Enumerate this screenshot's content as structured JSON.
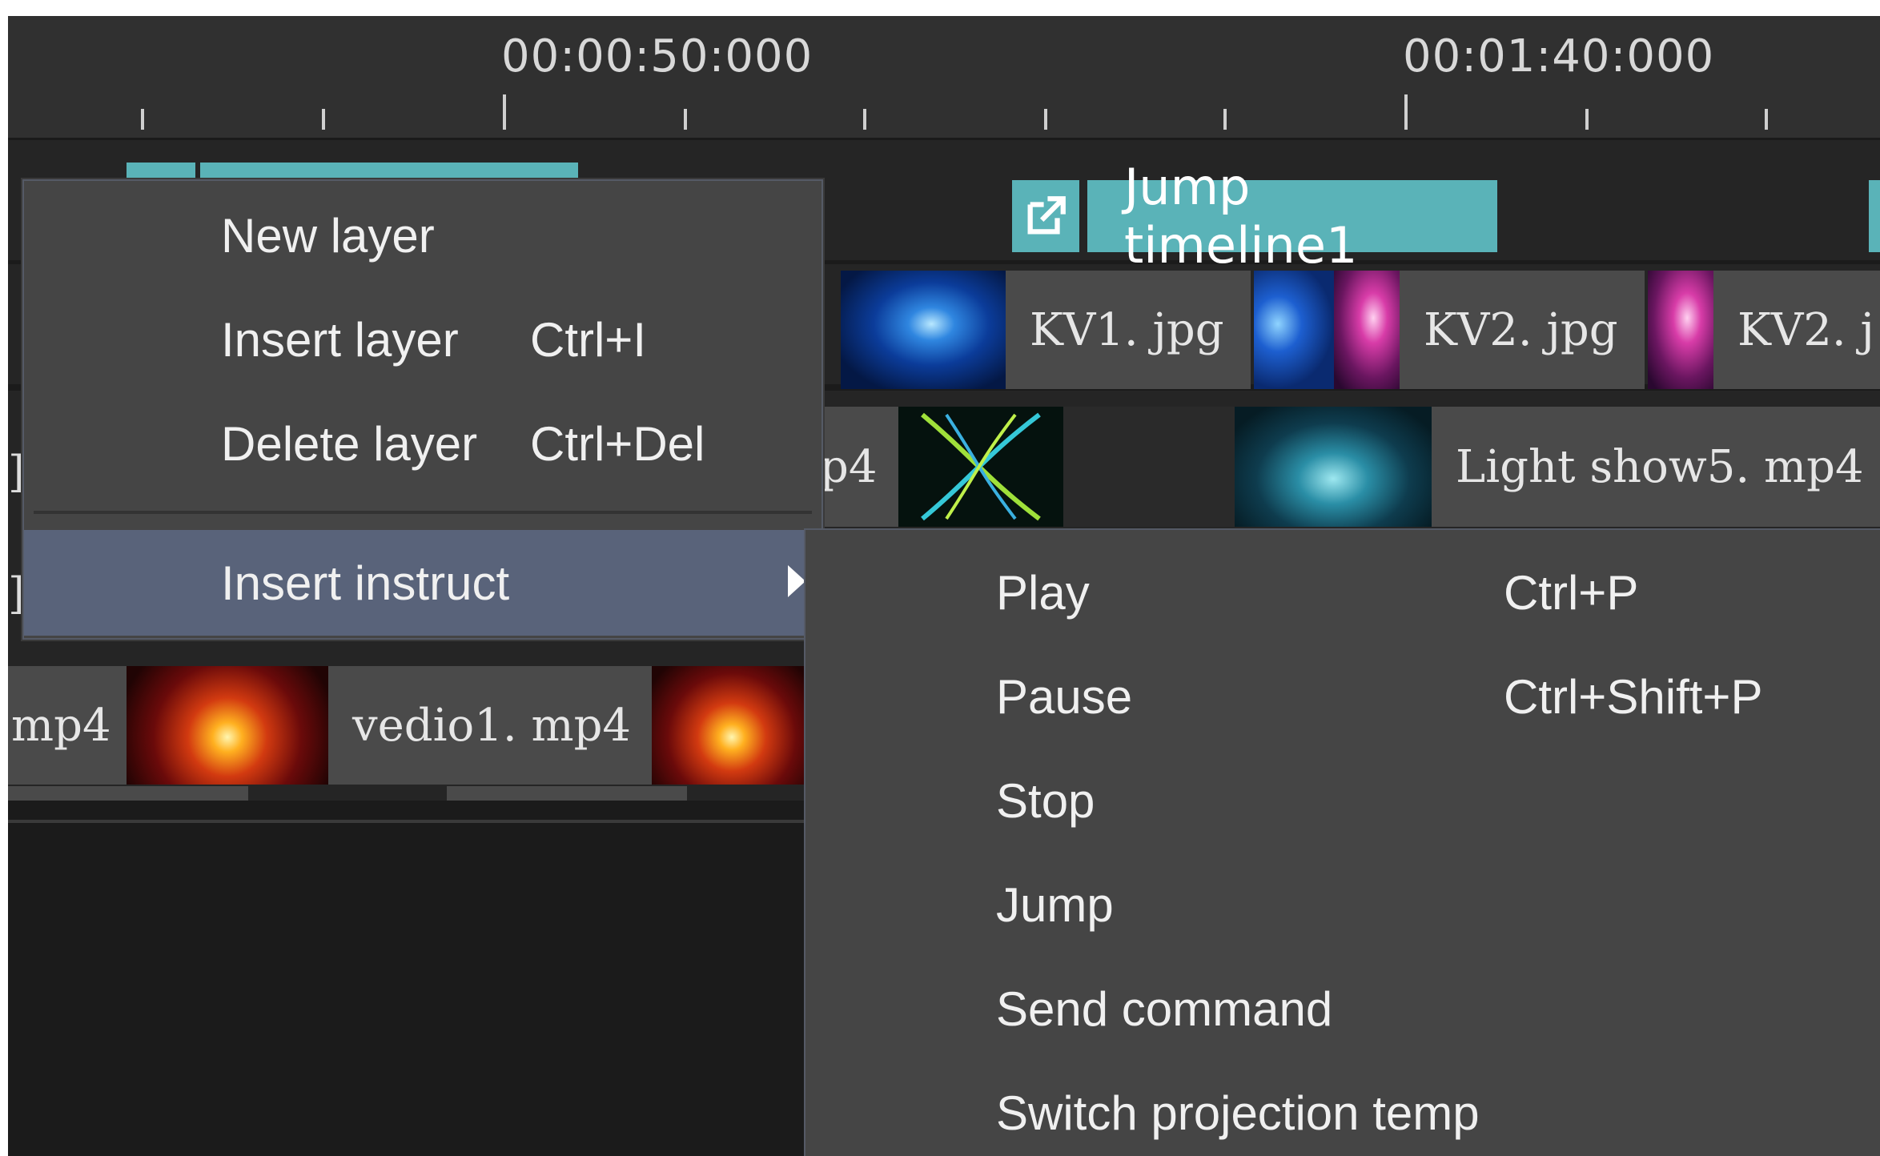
{
  "ruler": {
    "labels": [
      "00:00:50:000",
      "00:01:40:000"
    ]
  },
  "tracks": {
    "instruction_clip": {
      "label": "Jump timeline1",
      "icon": "external-link-icon"
    },
    "image_clips": [
      "KV1. jpg",
      "KV2. jpg",
      "KV2. j"
    ],
    "video_clips_row1": [
      "p4",
      "Light  show5. mp4"
    ],
    "video_clips_row2": [
      "mp4",
      "vedio1. mp4"
    ],
    "edge_glyphs": [
      "]",
      "]"
    ]
  },
  "context_menu": {
    "items": [
      {
        "label": "New layer",
        "shortcut": ""
      },
      {
        "label": "Insert layer",
        "shortcut": "Ctrl+I"
      },
      {
        "label": "Delete layer",
        "shortcut": "Ctrl+Del"
      },
      {
        "label": "Insert instruct",
        "shortcut": ""
      }
    ]
  },
  "submenu": {
    "items": [
      {
        "label": "Play",
        "shortcut": "Ctrl+P"
      },
      {
        "label": "Pause",
        "shortcut": "Ctrl+Shift+P"
      },
      {
        "label": "Stop",
        "shortcut": ""
      },
      {
        "label": "Jump",
        "shortcut": ""
      },
      {
        "label": "Send command",
        "shortcut": ""
      },
      {
        "label": "Switch projection temp",
        "shortcut": ""
      }
    ]
  },
  "colors": {
    "accent_teal": "#5ab3b8",
    "menu_bg": "#454545",
    "menu_highlight": "#59637a",
    "background": "#1b1b1b"
  }
}
